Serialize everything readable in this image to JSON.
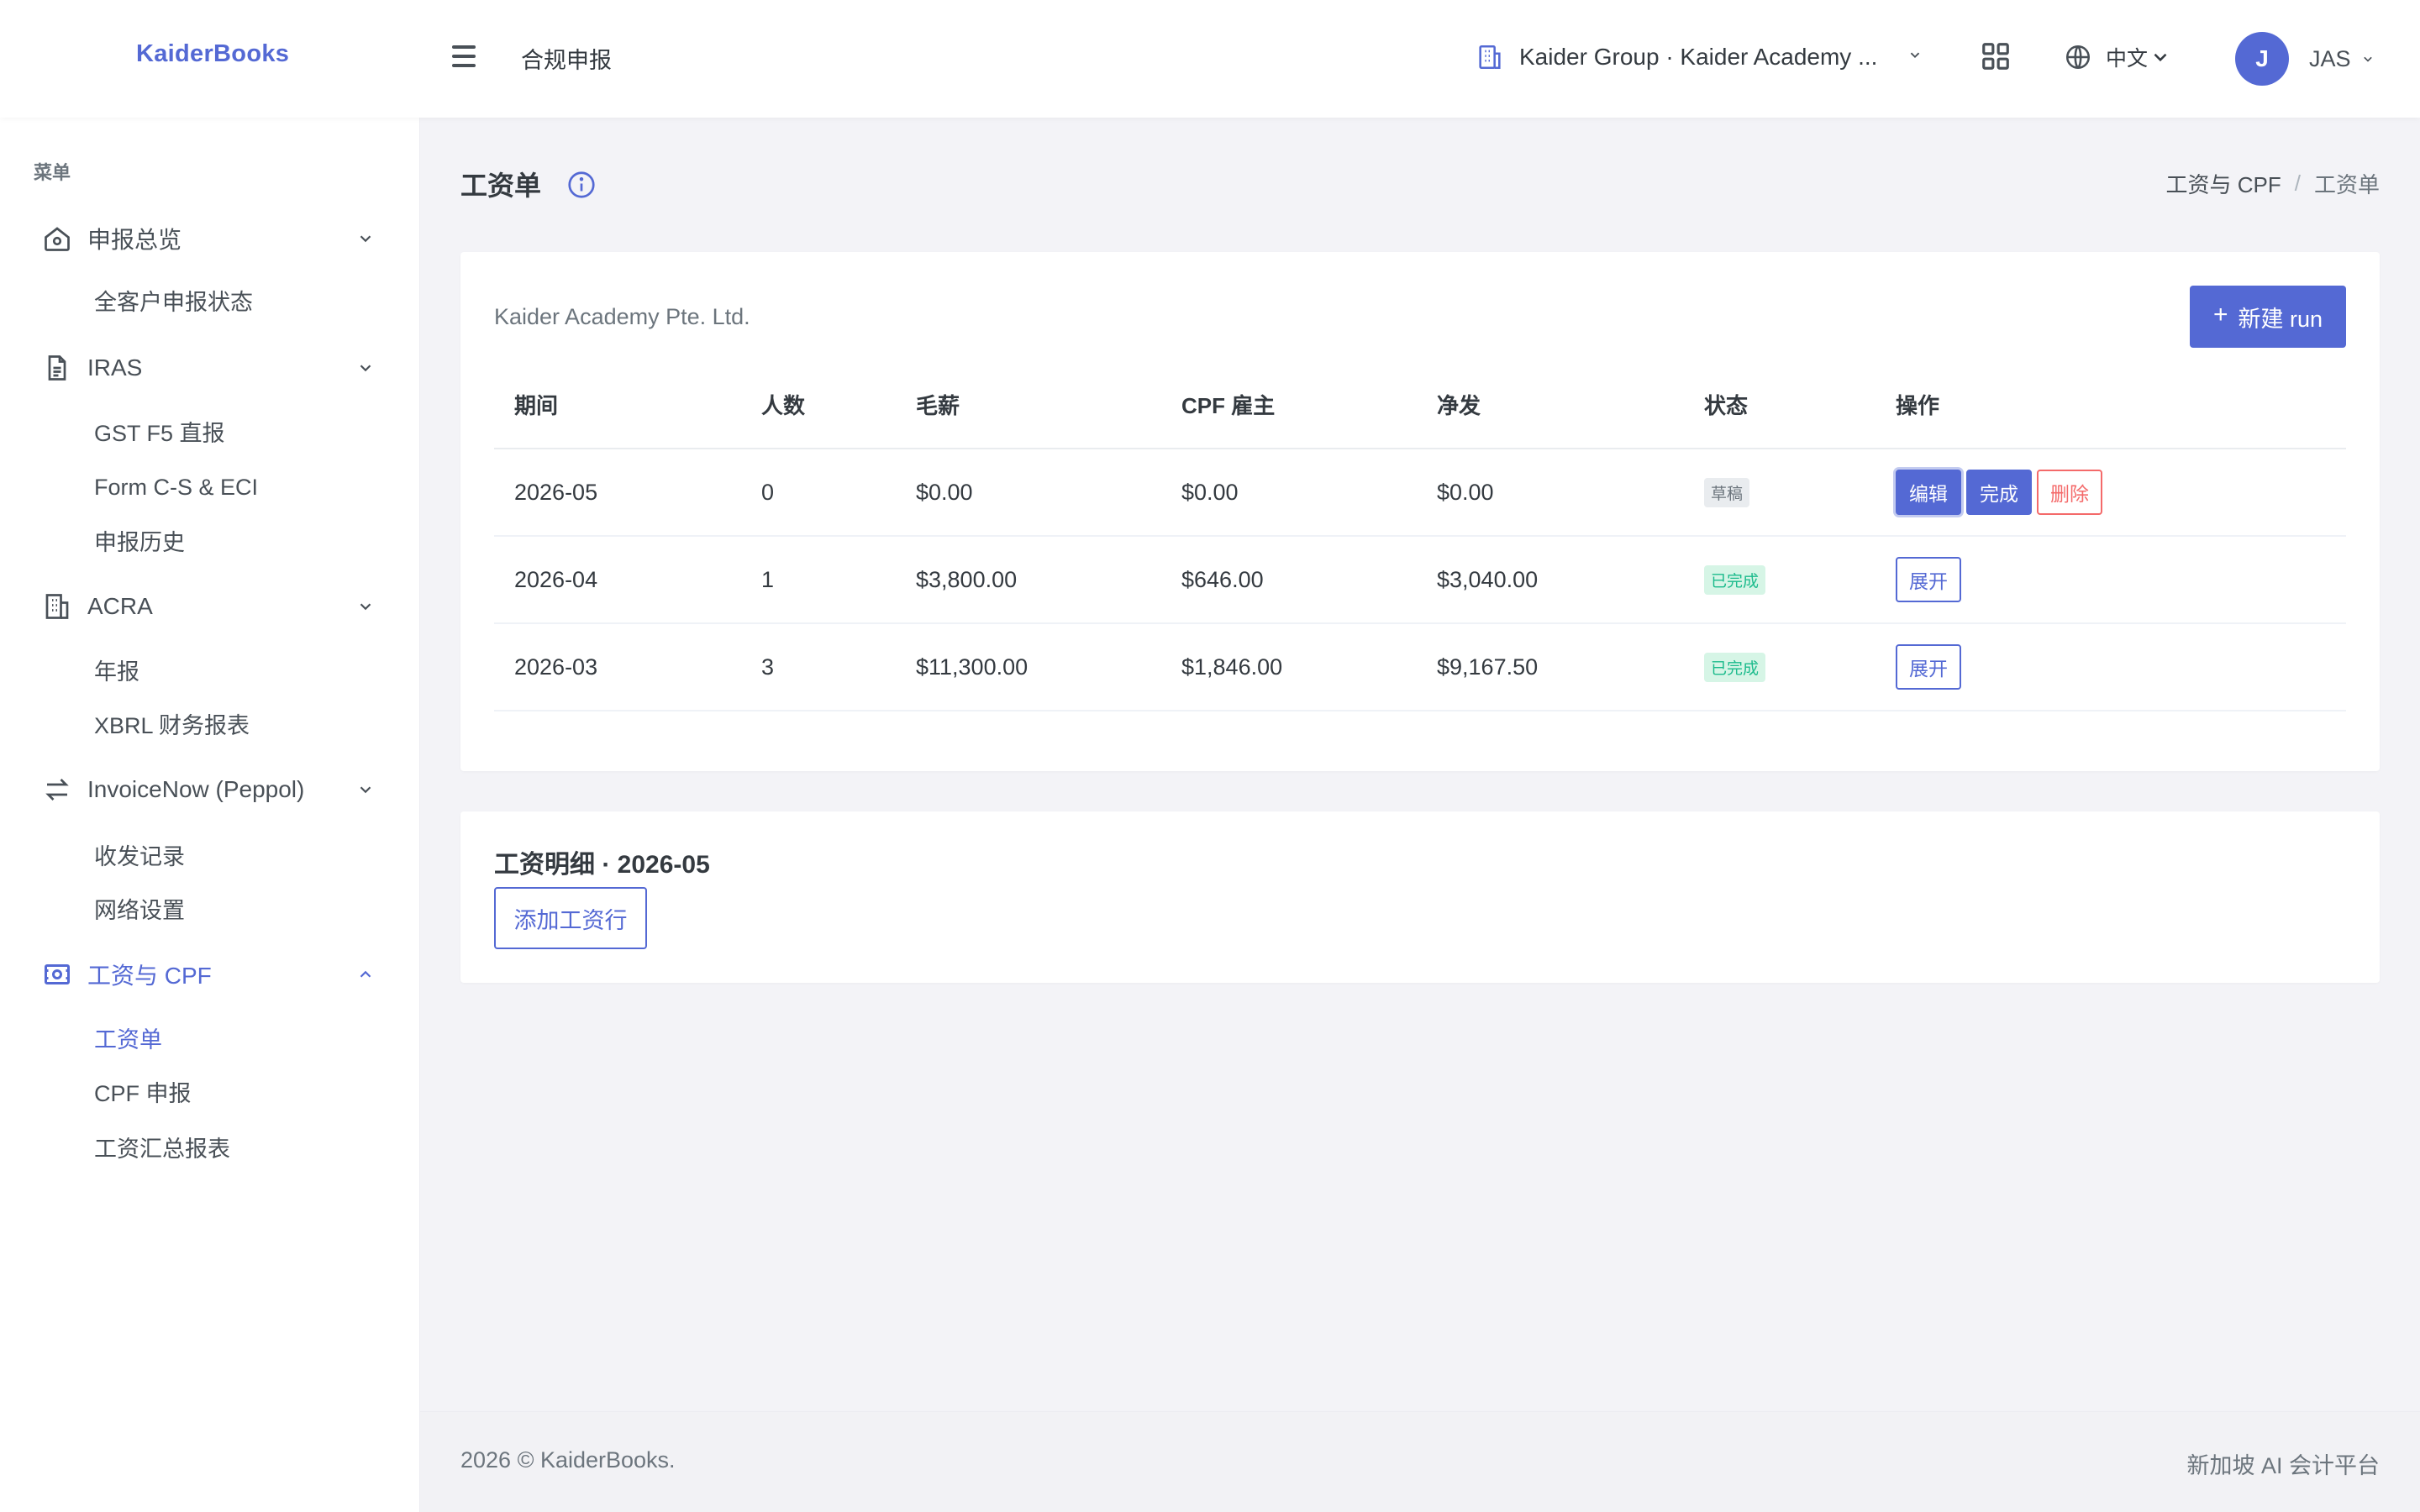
{
  "header": {
    "brand": "KaiderBooks",
    "page_context": "合规申报",
    "company_selector": "Kaider Group · Kaider Academy ...",
    "language": "中文",
    "user_initial": "J",
    "user_name": "JAS"
  },
  "sidebar": {
    "menu_heading": "菜单",
    "groups": [
      {
        "label": "申报总览",
        "icon": "home-icon",
        "items": [
          "全客户申报状态"
        ]
      },
      {
        "label": "IRAS",
        "icon": "document-icon",
        "items": [
          "GST F5 直报",
          "Form C-S & ECI",
          "申报历史"
        ]
      },
      {
        "label": "ACRA",
        "icon": "building-icon",
        "items": [
          "年报",
          "XBRL 财务报表"
        ]
      },
      {
        "label": "InvoiceNow (Peppol)",
        "icon": "swap-arrows-icon",
        "items": [
          "收发记录",
          "网络设置"
        ]
      },
      {
        "label": "工资与 CPF",
        "icon": "money-icon",
        "items": [
          "工资单",
          "CPF 申报",
          "工资汇总报表"
        ],
        "active": true,
        "active_item": "工资单"
      }
    ]
  },
  "page": {
    "title": "工资单",
    "breadcrumb": [
      "工资与 CPF",
      "工资单"
    ]
  },
  "runs_card": {
    "company": "Kaider Academy Pte. Ltd.",
    "new_button": "新建 run",
    "columns": [
      "期间",
      "人数",
      "毛薪",
      "CPF 雇主",
      "净发",
      "状态",
      "操作"
    ],
    "rows": [
      {
        "period": "2026-05",
        "headcount": "0",
        "gross": "$0.00",
        "cpf_employer": "$0.00",
        "net": "$0.00",
        "status": "草稿",
        "actions": [
          "编辑",
          "完成",
          "删除"
        ]
      },
      {
        "period": "2026-04",
        "headcount": "1",
        "gross": "$3,800.00",
        "cpf_employer": "$646.00",
        "net": "$3,040.00",
        "status": "已完成",
        "actions": [
          "展开"
        ]
      },
      {
        "period": "2026-03",
        "headcount": "3",
        "gross": "$11,300.00",
        "cpf_employer": "$1,846.00",
        "net": "$9,167.50",
        "status": "已完成",
        "actions": [
          "展开"
        ]
      }
    ]
  },
  "detail_card": {
    "title": "工资明细 · 2026-05",
    "add_button": "添加工资行"
  },
  "footer": {
    "left": "2026 © KaiderBooks.",
    "right": "新加坡 AI 会计平台"
  },
  "colors": {
    "primary": "#5469d4",
    "success": "#1cbb8c",
    "danger": "#f46a6a"
  }
}
